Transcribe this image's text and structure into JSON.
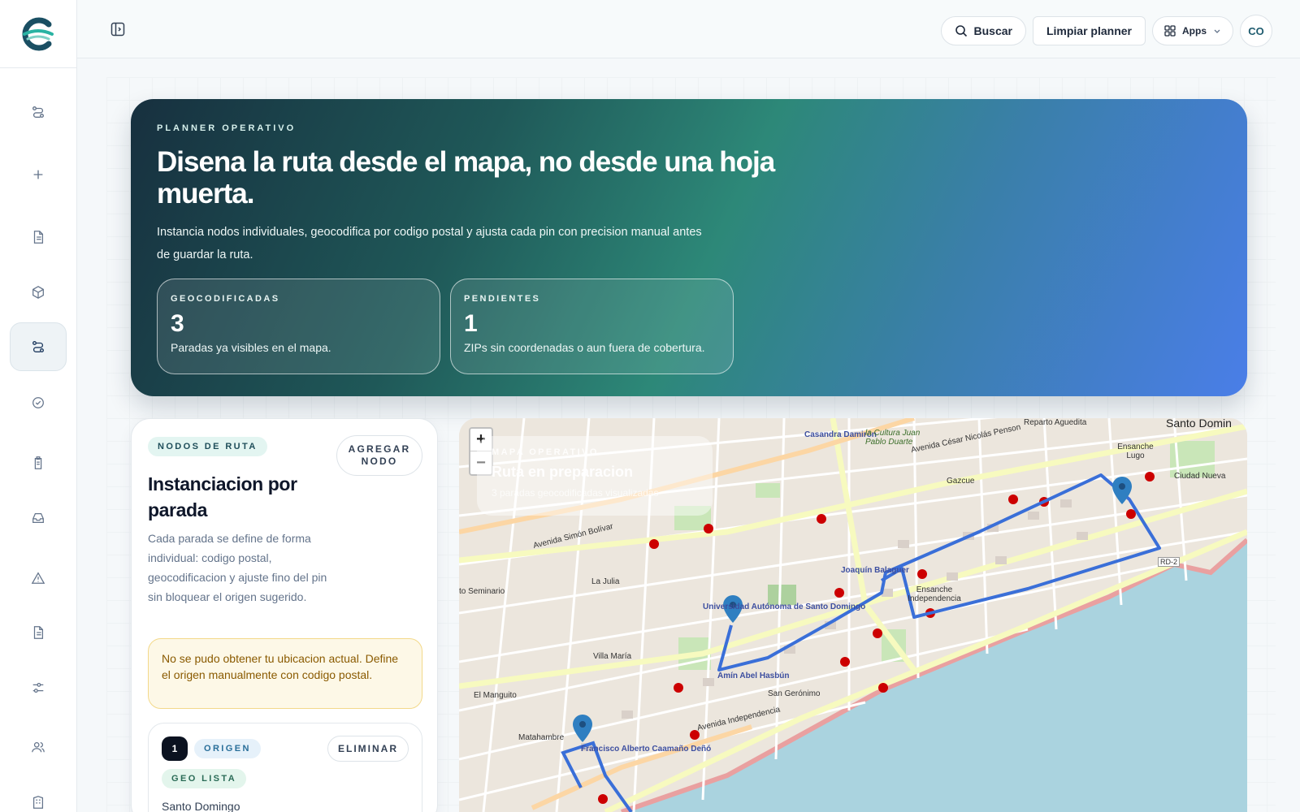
{
  "header": {
    "search_label": "Buscar",
    "clear_label": "Limpiar planner",
    "apps_label": "Apps",
    "avatar_initials": "CO"
  },
  "hero": {
    "eyebrow": "PLANNER OPERATIVO",
    "title": "Disena la ruta desde el mapa, no desde una hoja muerta.",
    "lead": "Instancia nodos individuales, geocodifica por codigo postal y ajusta cada pin con precision manual antes de guardar la ruta.",
    "stats": [
      {
        "label": "GEOCODIFICADAS",
        "value": "3",
        "desc": "Paradas ya visibles en el mapa."
      },
      {
        "label": "PENDIENTES",
        "value": "1",
        "desc": "ZIPs sin coordenadas o aun fuera de cobertura."
      }
    ]
  },
  "panel": {
    "badge": "NODOS DE RUTA",
    "add_node": "AGREGAR NODO",
    "title": "Instanciacion por parada",
    "description": "Cada parada se define de forma individual: codigo postal, geocodificacion y ajuste fino del pin sin bloquear el origen sugerido.",
    "warning": "No se pudo obtener tu ubicacion actual. Define el origen manualmente con codigo postal.",
    "stop": {
      "number": "1",
      "type_badge": "ORIGEN",
      "remove": "ELIMINAR",
      "geo_badge": "GEO LISTA",
      "city": "Santo Domingo"
    }
  },
  "map": {
    "overlay_eyebrow": "MAPA OPERATIVO",
    "overlay_title": "Ruta en preparacion",
    "overlay_sub": "3 paradas geocodificadas visualizadas",
    "zoom_in": "+",
    "zoom_out": "−",
    "route_color": "#3a6fd8",
    "pin_color": "#2f7fc1",
    "labels": {
      "santo_domingo": "Santo Domin",
      "casandra": "Casandra Damirón",
      "cultura": "la Cultura Juan Pablo Duarte",
      "cesar_penson": "Avenida César Nicolás Penson",
      "reparto": "Reparto Aguedita",
      "simon_bolivar": "Avenida Simón Bolívar",
      "ensanche_lugo": "Ensanche Lugo",
      "ciudad_nueva": "Ciudad Nueva",
      "gazcue": "Gazcue",
      "la_julia": "La Julia",
      "seminario": "to Seminario",
      "universidad": "Universidad Autónoma de Santo Domingo",
      "joaquin": "Joaquín Balaguer",
      "independencia_ens": "Ensanche Independencia",
      "villa_maria": "Villa María",
      "amin": "Amín Abel Hasbún",
      "san_geronimo": "San Gerónimo",
      "el_manguito": "El Manguito",
      "matahambre": "Matahambre",
      "francisco": "Francisco Alberto Caamaño Deñó",
      "av_independencia": "Avenida Independencia",
      "rd2": "RD-2"
    }
  }
}
